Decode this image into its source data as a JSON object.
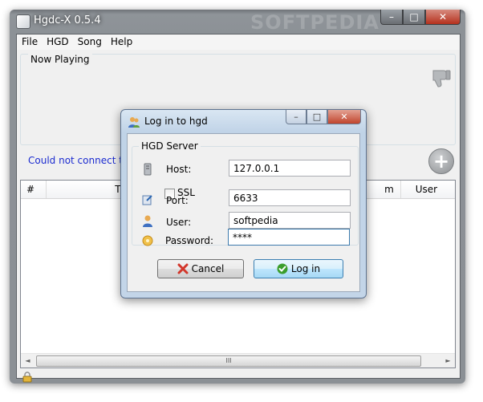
{
  "window": {
    "title": "Hgdc-X 0.5.4",
    "watermark": "SOFTPEDIA",
    "controls": {
      "minimize": "–",
      "maximize": "□",
      "close": "✕"
    }
  },
  "menu": {
    "items": [
      "File",
      "HGD",
      "Song",
      "Help"
    ]
  },
  "now_playing": {
    "label": "Now Playing",
    "icon": "thumbs-down-icon"
  },
  "status": {
    "text": "Could not connect to"
  },
  "add_icon": "+",
  "playlist": {
    "columns": [
      "#",
      "Title",
      "m",
      "User"
    ]
  },
  "scrollbar": {
    "left": "◄",
    "right": "►",
    "grip": "III"
  },
  "dialog": {
    "title": "Log in to hgd",
    "controls": {
      "minimize": "–",
      "maximize": "□",
      "close": "✕"
    },
    "group_label": "HGD Server",
    "host_label": "Host:",
    "host_value": "127.0.0.1",
    "ssl_label": "SSL",
    "port_label": "Port:",
    "port_value": "6633",
    "user_label": "User:",
    "user_value": "softpedia",
    "password_label": "Password:",
    "password_value": "****",
    "cancel_label": "Cancel",
    "login_label": "Log in"
  },
  "colors": {
    "status_text": "#1b2bd0",
    "dialog_frame": "#c0d3e7",
    "cancel_icon": "#d2362a",
    "login_icon": "#3a9d2b"
  }
}
